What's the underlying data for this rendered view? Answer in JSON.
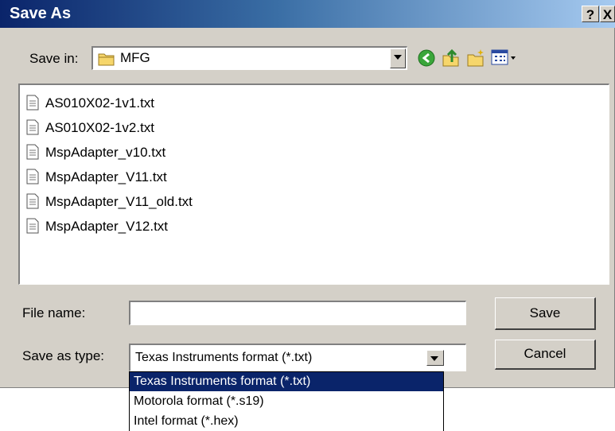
{
  "window": {
    "title": "Save As",
    "help_button": "?",
    "close_button": "X"
  },
  "save_in": {
    "label": "Save in:",
    "value": "MFG"
  },
  "toolbar": {
    "icons": [
      "back-icon",
      "up-folder-icon",
      "new-folder-icon",
      "view-menu-icon"
    ]
  },
  "files": [
    {
      "name": "AS010X02-1v1.txt",
      "icon": "text-file-icon"
    },
    {
      "name": "AS010X02-1v2.txt",
      "icon": "text-file-icon"
    },
    {
      "name": "MspAdapter_v10.txt",
      "icon": "text-file-icon"
    },
    {
      "name": "MspAdapter_V11.txt",
      "icon": "text-file-icon"
    },
    {
      "name": "MspAdapter_V11_old.txt",
      "icon": "text-file-icon"
    },
    {
      "name": "MspAdapter_V12.txt",
      "icon": "text-file-icon"
    }
  ],
  "file_name": {
    "label": "File name:",
    "value": ""
  },
  "save_as_type": {
    "label": "Save as type:",
    "value": "Texas Instruments format (*.txt)",
    "options": [
      "Texas Instruments format (*.txt)",
      "Motorola format  (*.s19)",
      "Intel format    (*.hex)"
    ]
  },
  "buttons": {
    "save": "Save",
    "cancel": "Cancel"
  },
  "colors": {
    "title_start": "#0a246a",
    "title_end": "#a6caf0",
    "face": "#d4d0c8",
    "selection": "#0a246a"
  }
}
